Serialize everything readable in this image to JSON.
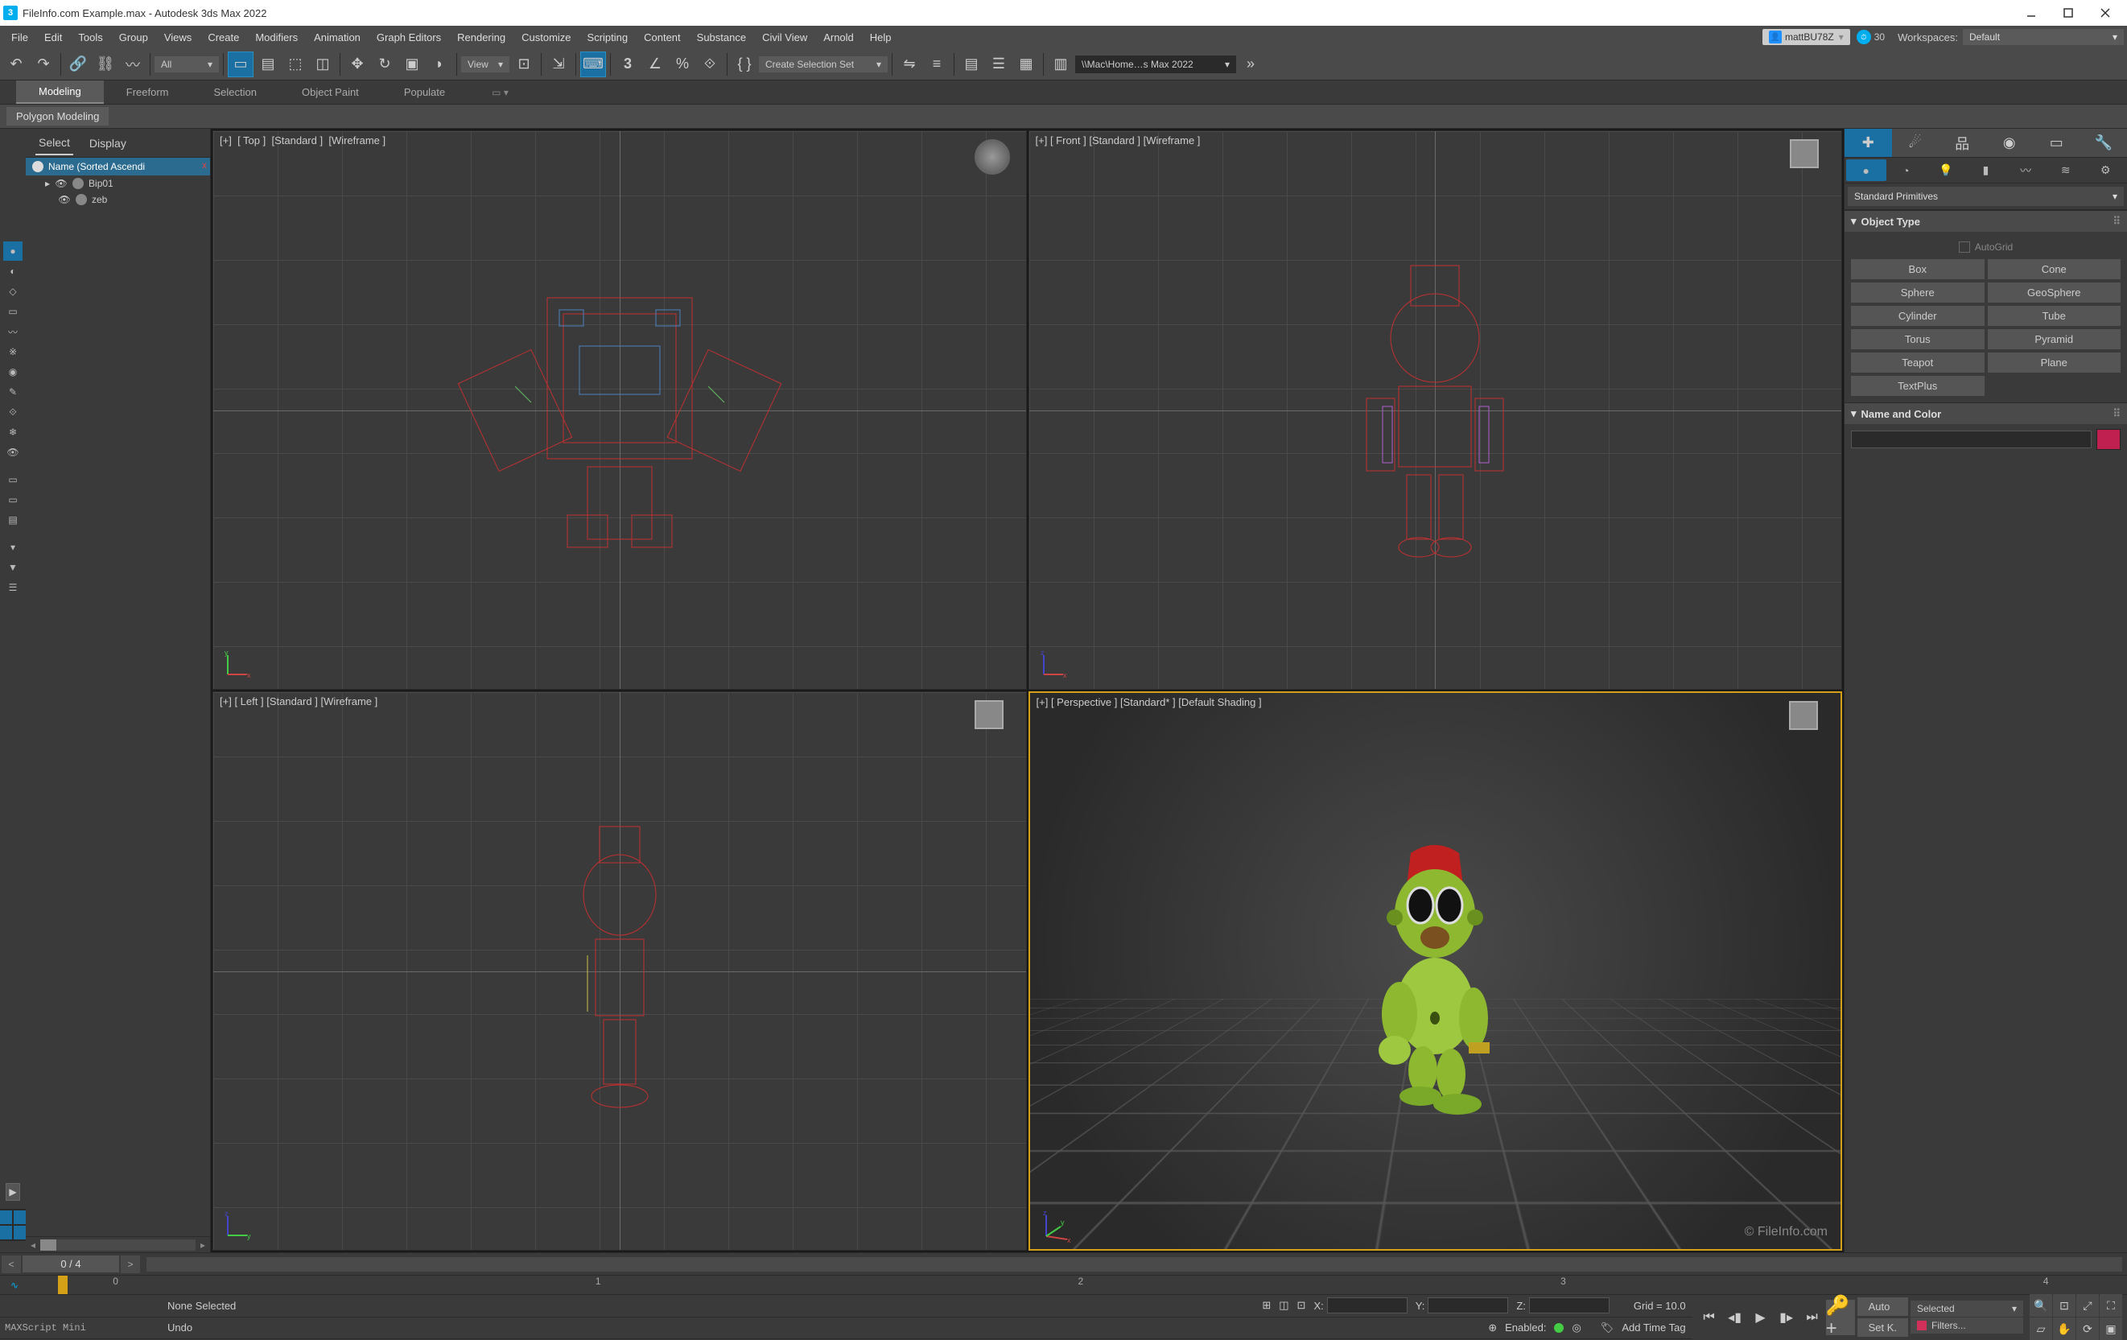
{
  "title": "FileInfo.com Example.max - Autodesk 3ds Max 2022",
  "menu": [
    "File",
    "Edit",
    "Tools",
    "Group",
    "Views",
    "Create",
    "Modifiers",
    "Animation",
    "Graph Editors",
    "Rendering",
    "Customize",
    "Scripting",
    "Content",
    "Substance",
    "Civil View",
    "Arnold",
    "Help"
  ],
  "user": "mattBU78Z",
  "days": "30",
  "workspace_label": "Workspaces:",
  "workspace_value": "Default",
  "toolbar": {
    "filter_dd": "All",
    "view_dd": "View",
    "selset_dd": "Create Selection Set",
    "path": "\\\\Mac\\Home…s Max 2022"
  },
  "ribbon": {
    "tabs": [
      "Modeling",
      "Freeform",
      "Selection",
      "Object Paint",
      "Populate"
    ],
    "panel_btn": "Polygon Modeling"
  },
  "scene_explorer": {
    "tabs": [
      "Select",
      "Display"
    ],
    "header": "Name (Sorted Ascendi",
    "items": [
      {
        "name": "Bip01",
        "type": "bone"
      },
      {
        "name": "zeb",
        "type": "mesh"
      }
    ]
  },
  "viewports": [
    {
      "labels": [
        "[+]",
        "[ Top ]",
        "[Standard ]",
        "[Wireframe ]"
      ],
      "axis": [
        "x",
        "y"
      ]
    },
    {
      "labels": [
        "[+]",
        "[ Front ]",
        "[Standard ]",
        "[Wireframe ]"
      ],
      "axis": [
        "x",
        "z"
      ]
    },
    {
      "labels": [
        "[+]",
        "[ Left ]",
        "[Standard ]",
        "[Wireframe ]"
      ],
      "axis": [
        "y",
        "z"
      ]
    },
    {
      "labels": [
        "[+]",
        "[ Perspective ]",
        "[Standard* ]",
        "[Default Shading ]"
      ],
      "axis": [
        "x",
        "y",
        "z"
      ]
    }
  ],
  "watermark": "© FileInfo.com",
  "cmdpanel": {
    "category_dd": "Standard Primitives",
    "object_type_hdr": "Object Type",
    "autogrid": "AutoGrid",
    "primitives": [
      "Box",
      "Cone",
      "Sphere",
      "GeoSphere",
      "Cylinder",
      "Tube",
      "Torus",
      "Pyramid",
      "Teapot",
      "Plane",
      "TextPlus"
    ],
    "name_color_hdr": "Name and Color"
  },
  "timeslider": {
    "frame": "0 / 4"
  },
  "trackbar_marks": [
    "0",
    "1",
    "2",
    "3",
    "4"
  ],
  "status": {
    "selection": "None Selected",
    "prompt": "Undo",
    "script": "MAXScript Mini",
    "coords": {
      "x": "X:",
      "y": "Y:",
      "z": "Z:"
    },
    "grid": "Grid = 10.0",
    "enabled_label": "Enabled:",
    "addtag": "Add Time Tag",
    "auto": "Auto",
    "setk": "Set K.",
    "sel_dd": "Selected",
    "filters": "Filters..."
  }
}
